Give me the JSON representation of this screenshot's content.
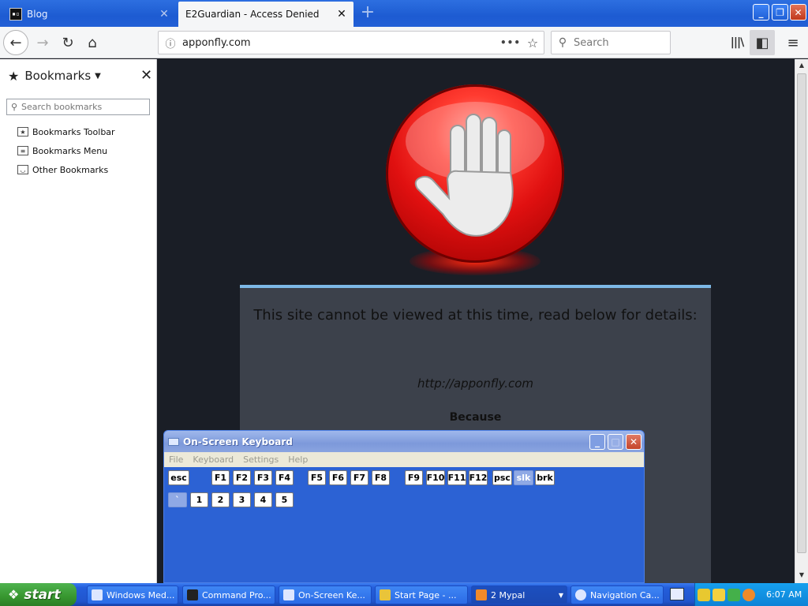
{
  "browser": {
    "tabs": [
      {
        "title": "Blog",
        "favicon": "terminal-icon"
      },
      {
        "title": "E2Guardian - Access Denied",
        "active": true
      }
    ],
    "url": "apponfly.com",
    "search_placeholder": "Search",
    "colors": {
      "titlebar": "#245edb",
      "toolbar": "#f5f6f7"
    }
  },
  "sidebar": {
    "title": "Bookmarks",
    "search_placeholder": "Search bookmarks",
    "items": [
      {
        "label": "Bookmarks Toolbar",
        "icon": "star-folder-icon"
      },
      {
        "label": "Bookmarks Menu",
        "icon": "menu-list-icon"
      },
      {
        "label": "Other Bookmarks",
        "icon": "tray-icon"
      }
    ]
  },
  "page": {
    "heading": "This site cannot be viewed at this time, read below for details:",
    "blocked_url": "http://apponfly.com",
    "reason_label": "Because",
    "colors": {
      "background": "#1a1e26",
      "panel": "#3c414b",
      "accent": "#7db8e6",
      "stop": "#e01010"
    }
  },
  "osk": {
    "title": "On-Screen Keyboard",
    "menu": [
      "File",
      "Keyboard",
      "Settings",
      "Help"
    ],
    "row1": [
      "esc",
      "F1",
      "F2",
      "F3",
      "F4",
      "F5",
      "F6",
      "F7",
      "F8",
      "F9",
      "F10",
      "F11",
      "F12",
      "psc",
      "slk",
      "brk"
    ],
    "row2": [
      "`",
      "1",
      "2",
      "3",
      "4",
      "5"
    ],
    "colors": {
      "body": "#2c62d4",
      "dim_key": "#8fa9e5"
    }
  },
  "taskbar": {
    "start_label": "start",
    "tasks": [
      {
        "label": "Windows Med...",
        "icon": "media-player-icon"
      },
      {
        "label": "Command Pro...",
        "icon": "cmd-icon"
      },
      {
        "label": "On-Screen Ke...",
        "icon": "keyboard-icon"
      },
      {
        "label": "Start Page - ...",
        "icon": "browser-icon"
      },
      {
        "label": "2 Mypal",
        "icon": "mypal-icon",
        "active": true
      },
      {
        "label": "Navigation Ca...",
        "icon": "help-icon"
      }
    ],
    "clock": "6:07 AM"
  }
}
